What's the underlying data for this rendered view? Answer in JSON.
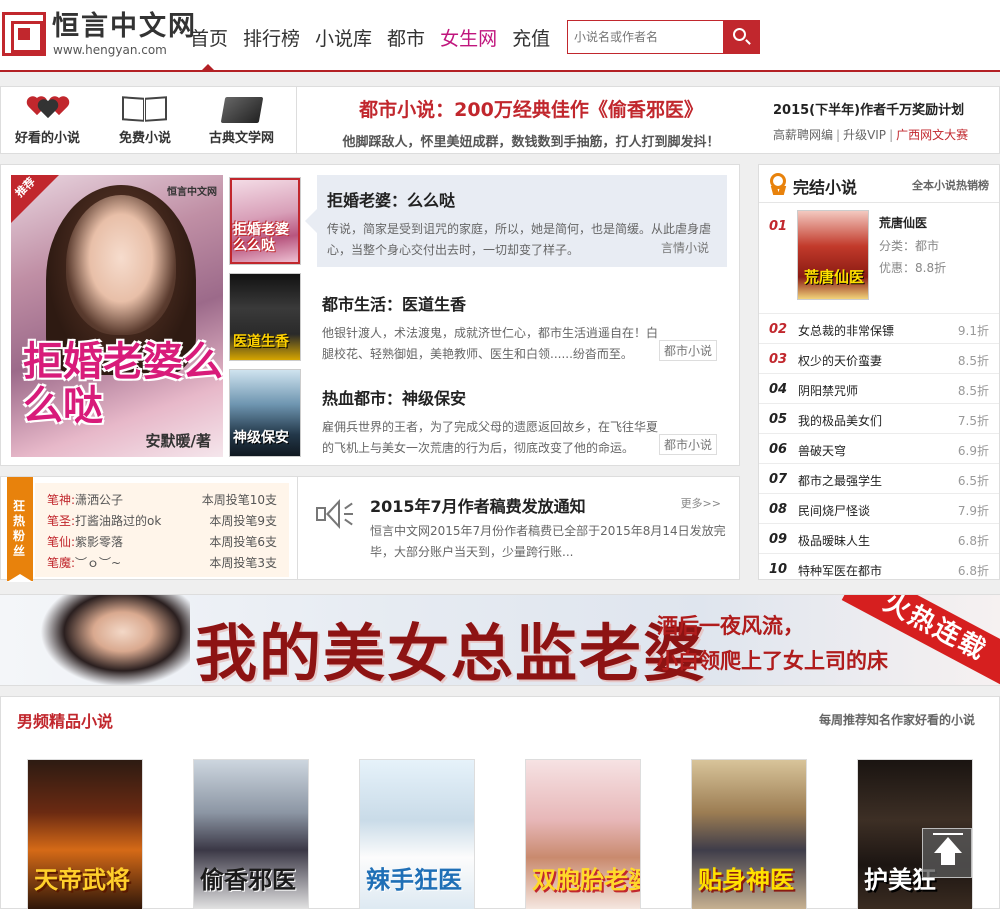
{
  "header": {
    "logo_text": "恒言中文网",
    "logo_url": "www.hengyan.com",
    "nav": [
      {
        "label": "首页"
      },
      {
        "label": "排行榜"
      },
      {
        "label": "小说库"
      },
      {
        "label": "都市"
      },
      {
        "label": "女生网"
      },
      {
        "label": "充值"
      }
    ],
    "search_placeholder": "小说名或作者名",
    "search_icon": "search-icon",
    "accent_color": "#c1272d"
  },
  "promo": {
    "icons": [
      {
        "label": "好看的小说",
        "icon": "hearts-icon"
      },
      {
        "label": "免费小说",
        "icon": "open-book-icon"
      },
      {
        "label": "古典文学网",
        "icon": "classic-book-icon"
      }
    ],
    "headline": "都市小说：200万经典佳作《偷香邪医》",
    "subline": "他脚踩敌人，怀里美妞成群，数钱数到手抽筋，打人打到脚发抖！",
    "right_title": "2015(下半年)作者千万奖励计划",
    "right_links": [
      "高薪聘网编",
      "升级VIP",
      "广西网文大赛"
    ]
  },
  "featured": {
    "badge": "推荐",
    "cover": {
      "title": "拒婚老婆么么哒",
      "author": "安默暖/著",
      "brand": "恒言中文网"
    },
    "thumbs": [
      {
        "title": "拒婚老婆么么哒"
      },
      {
        "title": "医道生香"
      },
      {
        "title": "神级保安"
      }
    ],
    "items": [
      {
        "title": "拒婚老婆：么么哒",
        "desc": "传说，简家是受到诅咒的家庭，所以，她是简何，也是简缓。从此虐身虐心，当整个身心交付出去时，一切却变了样子。",
        "tag": "言情小说"
      },
      {
        "title": "都市生活：医道生香",
        "desc": "他银针渡人，术法渡鬼，成就济世仁心，都市生活逍遥自在！白腿校花、轻熟御姐，美艳教师、医生和白领......纷沓而至。",
        "tag": "都市小说"
      },
      {
        "title": "热血都市：神级保安",
        "desc": "雇佣兵世界的王者，为了完成父母的遗愿返回故乡，在飞往华夏的飞机上与美女一次荒唐的行为后，彻底改变了他的命运。",
        "tag": "都市小说"
      }
    ]
  },
  "fans": {
    "label": "狂热粉丝",
    "rows": [
      {
        "rank": "笔神:",
        "name": "潇洒公子",
        "value": "本周投笔10支"
      },
      {
        "rank": "笔圣:",
        "name": "打酱油路过的ok",
        "value": "本周投笔9支"
      },
      {
        "rank": "笔仙:",
        "name": "紫影零落",
        "value": "本周投笔6支"
      },
      {
        "rank": "笔魔:",
        "name": "︶ｏ︶~",
        "value": "本周投笔3支"
      }
    ]
  },
  "notice": {
    "title": "2015年7月作者稿费发放通知",
    "more": "更多>>",
    "desc": "恒言中文网2015年7月份作者稿费已全部于2015年8月14日发放完毕，大部分账户当天到，少量跨行账..."
  },
  "rank": {
    "title": "完结小说",
    "subtitle": "全本小说热销榜",
    "top": {
      "num": "01",
      "title": "荒唐仙医",
      "cover_title": "荒唐仙医",
      "category_label": "分类：",
      "category": "都市",
      "discount": "优惠：8.8折"
    },
    "rows": [
      {
        "num": "02",
        "name": "女总裁的非常保镖",
        "discount": "9.1折"
      },
      {
        "num": "03",
        "name": "权少的天价蛮妻",
        "discount": "8.5折"
      },
      {
        "num": "04",
        "name": "阴阳禁咒师",
        "discount": "8.5折"
      },
      {
        "num": "05",
        "name": "我的极品美女们",
        "discount": "7.5折"
      },
      {
        "num": "06",
        "name": "兽破天穹",
        "discount": "6.9折"
      },
      {
        "num": "07",
        "name": "都市之最强学生",
        "discount": "6.5折"
      },
      {
        "num": "08",
        "name": "民间烧尸怪谈",
        "discount": "7.9折"
      },
      {
        "num": "09",
        "name": "极品暧昧人生",
        "discount": "6.8折"
      },
      {
        "num": "10",
        "name": "特种军医在都市",
        "discount": "6.8折"
      }
    ]
  },
  "banner": {
    "main": "我的美女总监老婆",
    "sub1": "酒后一夜风流，",
    "sub2": "小白领爬上了女上司的床",
    "ribbon": "火热连载"
  },
  "male": {
    "title": "男频精品小说",
    "subtitle": "每周推荐知名作家好看的小说",
    "covers": [
      {
        "title": "天帝武将"
      },
      {
        "title": "偷香邪医"
      },
      {
        "title": "辣手狂医"
      },
      {
        "title": "双胞胎老婆"
      },
      {
        "title": "贴身神医"
      },
      {
        "title": "护美狂"
      }
    ]
  },
  "to_top_icon": "back-to-top-icon"
}
